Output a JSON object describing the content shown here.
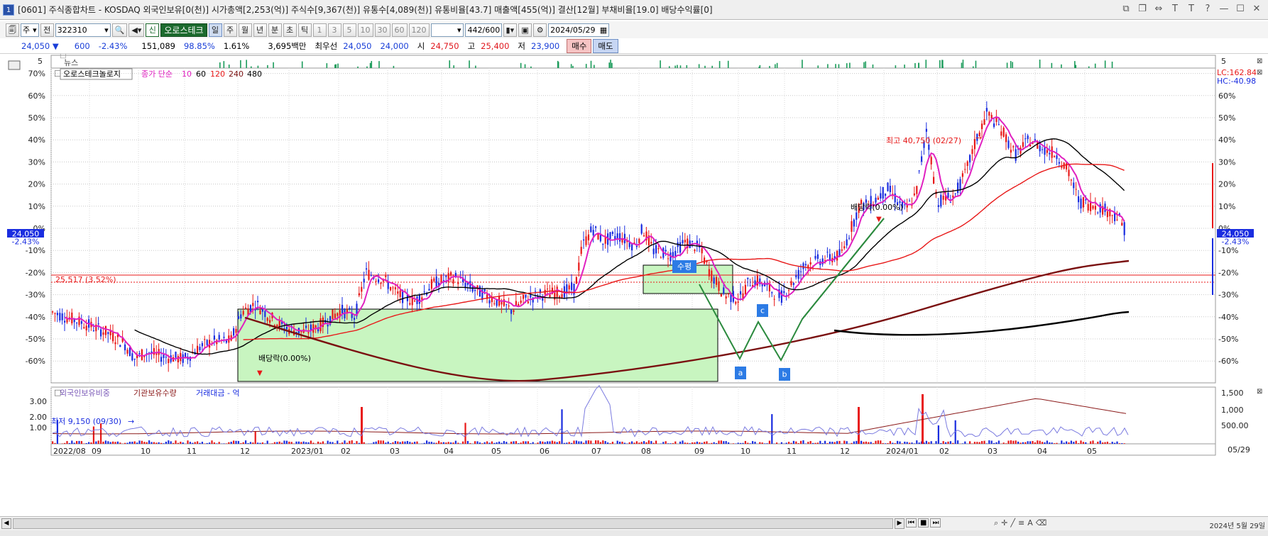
{
  "window": {
    "number": "1",
    "title": "[0601] 주식종합차트 - KOSDAQ 외국인보유[0(천)] 시가총액[2,253(억)] 주식수[9,367(천)] 유통수[4,089(천)] 유통비율[43.7] 매출액[455(억)] 결산[12월] 부채비율[19.0] 배당수익률[0]"
  },
  "toolbar": {
    "icon1": "🗐",
    "market": "주",
    "prev": "전",
    "code": "322310",
    "shin": "신",
    "stock_name": "오로스테크",
    "periods": [
      "일",
      "주",
      "월",
      "년",
      "분",
      "초",
      "틱"
    ],
    "active_period": "일",
    "minutes": [
      "1",
      "3",
      "5",
      "10",
      "30",
      "60",
      "120"
    ],
    "count": "442/600",
    "date": "2024/05/29"
  },
  "quote": {
    "price": "24,050",
    "change_arrow": "▼",
    "change": "600",
    "change_pct": "-2.43%",
    "volume": "151,089",
    "vol_ratio": "98.85%",
    "turnover": "1.61%",
    "amount": "3,695백만",
    "best_ask_label": "최우선",
    "best_ask": "24,050",
    "best_bid": "24,000",
    "open_label": "시",
    "open": "24,750",
    "high_label": "고",
    "high": "25,400",
    "low_label": "저",
    "low": "23,900",
    "buy": "매수",
    "sell": "매도"
  },
  "news_panel": {
    "label": "뉴스",
    "axis_value": "5",
    "left_axis_value": "5"
  },
  "main_panel": {
    "legend": {
      "stock": "오로스테크놀로지",
      "ma_label": "종가 단순",
      "ma_periods": [
        "10",
        "60",
        "120",
        "240",
        "480"
      ]
    },
    "left_y_ticks": [
      "70%",
      "60%",
      "50%",
      "40%",
      "30%",
      "20%",
      "10%",
      "0%",
      "-10%",
      "-20%",
      "-30%",
      "-40%",
      "-50%",
      "-60%"
    ],
    "right_y_ticks": [
      "60%",
      "50%",
      "40%",
      "30%",
      "20%",
      "10%",
      "0%",
      "-10%",
      "-20%",
      "-30%",
      "-40%",
      "-50%",
      "-60%"
    ],
    "lc": "LC:162.84",
    "hc": "HC:-40.98",
    "current_price_label": "24,050",
    "current_change_label": "-2.43%",
    "ref_line_label": "25,517 (3.52%)",
    "annotations": {
      "high": "최고 40,750 (02/27)",
      "low": "최저 9,150 (09/30)",
      "dividend1": "배당락(0.00%)",
      "dividend2": "배당락(0.00%)",
      "box_label": "수평",
      "wave_a": "a",
      "wave_b": "b",
      "wave_c": "c"
    }
  },
  "sub_panel": {
    "legend": [
      "외국인보유비중",
      "기관보유수량",
      "거래대금 - 억"
    ],
    "left_ticks": [
      "3.00",
      "2.00",
      "1.00"
    ],
    "right_ticks": [
      "1,500",
      "1,000",
      "500.00"
    ]
  },
  "x_axis": {
    "labels": [
      "2022/08",
      "09",
      "10",
      "11",
      "12",
      "2023/01",
      "02",
      "03",
      "04",
      "05",
      "06",
      "07",
      "08",
      "09",
      "10",
      "11",
      "12",
      "2024/01",
      "02",
      "03",
      "04",
      "05"
    ],
    "last_date": "05/29"
  },
  "status": {
    "datetime": "2024년 5월 29일"
  },
  "colors": {
    "ma10": "#e020c0",
    "ma60": "#000000",
    "ma120": "#e81818",
    "ma240": "#7a1010",
    "ma480": "#000000",
    "up": "#e81818",
    "down": "#1a2de0",
    "box": "#c8f5c0"
  }
}
